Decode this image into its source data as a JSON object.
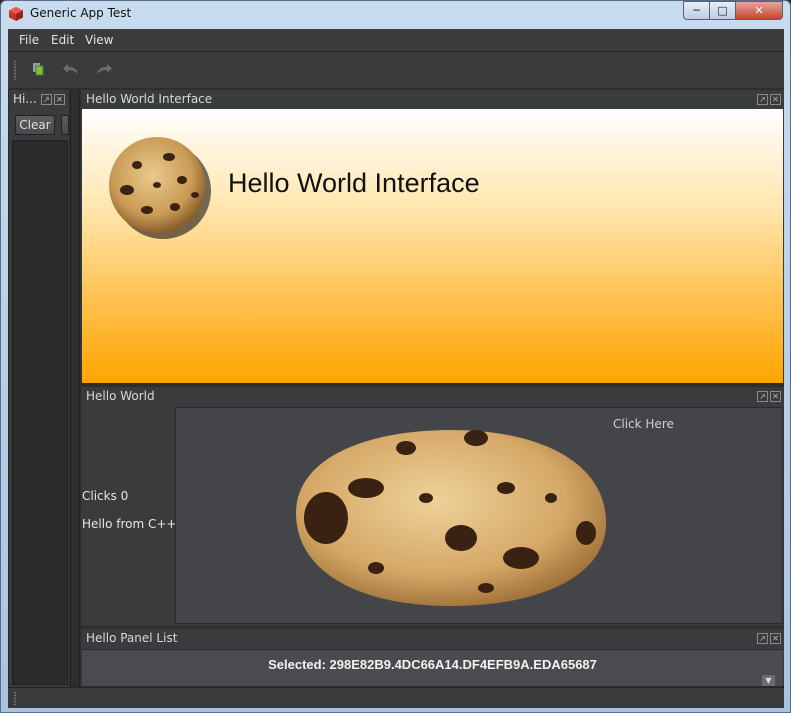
{
  "window": {
    "title": "Generic App Test"
  },
  "menubar": {
    "items": [
      "File",
      "Edit",
      "View"
    ]
  },
  "toolbar": {
    "icons": [
      "new-document-icon",
      "undo-icon",
      "redo-icon"
    ]
  },
  "history_dock": {
    "title": "Hi...",
    "clear_label": "Clear"
  },
  "interface_dock": {
    "title": "Hello World Interface",
    "heading": "Hello World Interface"
  },
  "hello_dock": {
    "title": "Hello World",
    "clicks": "Clicks 0",
    "cpp": "Hello from C++:",
    "click_here": "Click Here"
  },
  "panel_dock": {
    "title": "Hello Panel List",
    "selected": "Selected: 298E82B9.4DC66A14.DF4EFB9A.EDA65687"
  },
  "colors": {
    "accent_orange": "#ffa500",
    "dark_bg": "#3a3b3d",
    "close_red": "#c4432f"
  }
}
